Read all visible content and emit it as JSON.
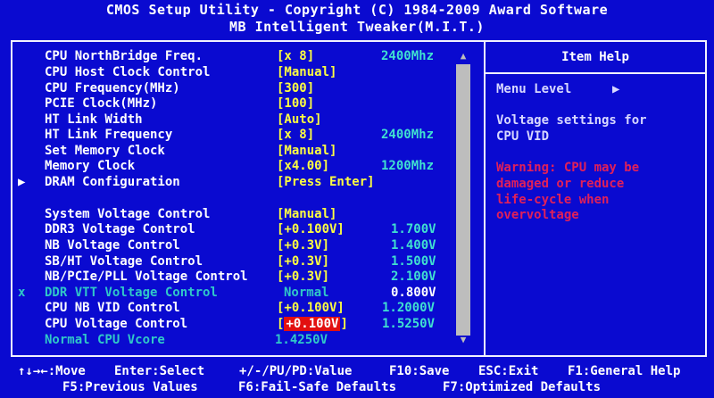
{
  "header": {
    "title": "CMOS Setup Utility - Copyright (C) 1984-2009 Award Software",
    "subtitle": "MB Intelligent Tweaker(M.I.T.)"
  },
  "settings": [
    {
      "label": "CPU NorthBridge Freq.",
      "value": "[x 8]",
      "info": "2400Mhz",
      "mark": ""
    },
    {
      "label": "CPU Host Clock Control",
      "value": "[Manual]",
      "info": "",
      "mark": ""
    },
    {
      "label": "CPU Frequency(MHz)",
      "value": "[300]",
      "info": "",
      "mark": ""
    },
    {
      "label": "PCIE Clock(MHz)",
      "value": "[100]",
      "info": "",
      "mark": ""
    },
    {
      "label": "HT Link Width",
      "value": "[Auto]",
      "info": "",
      "mark": ""
    },
    {
      "label": "HT Link Frequency",
      "value": "[x 8]",
      "info": "2400Mhz",
      "mark": ""
    },
    {
      "label": "Set Memory Clock",
      "value": "[Manual]",
      "info": "",
      "mark": ""
    },
    {
      "label": "Memory Clock",
      "value": "[x4.00]",
      "info": "1200Mhz",
      "mark": ""
    },
    {
      "label": "DRAM Configuration",
      "value": "[Press Enter]",
      "info": "",
      "mark": "▶"
    },
    {
      "label": "System Voltage Control",
      "value": "[Manual]",
      "info": "",
      "mark": ""
    },
    {
      "label": "DDR3 Voltage Control",
      "value": "[+0.100V]",
      "info": "1.700V",
      "mark": ""
    },
    {
      "label": "NB Voltage Control",
      "value": "[+0.3V]",
      "info": "1.400V",
      "mark": ""
    },
    {
      "label": "SB/HT Voltage Control",
      "value": "[+0.3V]",
      "info": "1.500V",
      "mark": ""
    },
    {
      "label": "NB/PCIe/PLL Voltage Control",
      "value": "[+0.3V]",
      "info": "2.100V",
      "mark": ""
    },
    {
      "label": "DDR VTT Voltage Control",
      "value": "Normal",
      "info": "0.800V",
      "mark": "x"
    },
    {
      "label": "CPU NB VID Control",
      "value": "[+0.100V]",
      "info": "1.2000V",
      "mark": ""
    },
    {
      "label": "CPU Voltage Control",
      "value": "[+0.100V]",
      "info": "1.5250V",
      "mark": ""
    },
    {
      "label": "Normal CPU Vcore",
      "value": "1.4250V",
      "info": "",
      "mark": ""
    }
  ],
  "help": {
    "title": "Item Help",
    "menu_level": "Menu Level",
    "menu_arrow": "▶",
    "desc_line1": "Voltage settings for",
    "desc_line2": "CPU VID",
    "warn_line1": "Warning: CPU may be",
    "warn_line2": "damaged or reduce",
    "warn_line3": "life-cycle when",
    "warn_line4": "overvoltage"
  },
  "scroll": {
    "up": "▲",
    "down": "▼"
  },
  "footer": {
    "move": "↑↓→←:Move",
    "select": "Enter:Select",
    "value": "+/-/PU/PD:Value",
    "save": "F10:Save",
    "exit": "ESC:Exit",
    "help": "F1:General Help",
    "prev": "F5:Previous Values",
    "failsafe": "F6:Fail-Safe Defaults",
    "optimized": "F7:Optimized Defaults"
  },
  "colors": {
    "background": "#0a0ad0",
    "label": "#ffffff",
    "value": "#ffff40",
    "info": "#40e0d0",
    "highlight": "#e21010",
    "warning": "#e0205a"
  }
}
